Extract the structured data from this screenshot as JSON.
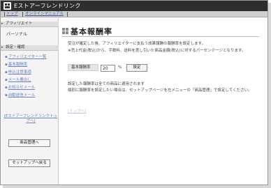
{
  "window": {
    "title": "Eストアーフレンドリンク"
  },
  "nav": {
    "items": [
      "トップ",
      "オンラインマニュアル"
    ]
  },
  "sidebar": {
    "affiliate_header": "アフィリエイト",
    "personal_label": "パーソナル",
    "settings_header": "設定・確認",
    "items": [
      "アフィリエイター一覧",
      "基本報酬率",
      "申込注意事項",
      "メール書出し",
      "お知らせメール",
      "自動送信メール"
    ],
    "friendlink_top": "[Eストアーフレンドリンクトップへ]",
    "product_button": "商品管理へ",
    "setup_button": "セットアップへ戻る"
  },
  "main": {
    "title": "基本報酬率",
    "description_1": "受注が確定した後、アフィリエイターに支払う成果報酬の報酬率を設定します。",
    "description_2": "※売上代金(税込)から、手数料、送料を差し引いた商品金額(税込)に対するパーセンテージとなります。",
    "rate_label": "基本報酬率",
    "rate_value": "20",
    "rate_unit": "%",
    "set_button": "設定",
    "note_1": "設定した報酬率は全ての商品に適用されます",
    "note_2": "個別に報酬率を設定したい場合は、セットアップページを左メニューの『商品管理』で設定してください。",
    "top_link": "[トップへ]"
  }
}
